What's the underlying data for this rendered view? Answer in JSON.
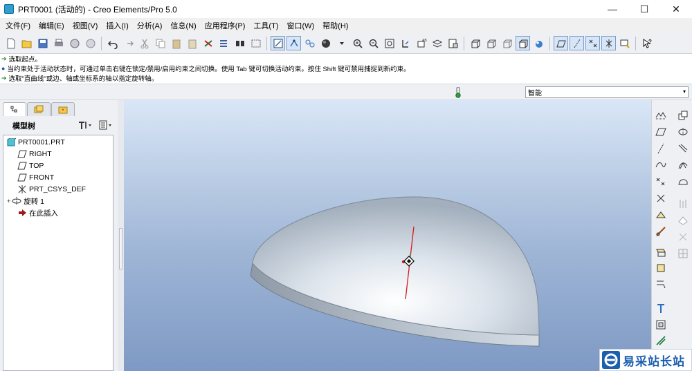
{
  "window": {
    "title": "PRT0001 (活动的) - Creo Elements/Pro 5.0",
    "controls": {
      "minimize": "—",
      "maximize": "☐",
      "close": "✕"
    }
  },
  "menu": [
    "文件(F)",
    "编辑(E)",
    "视图(V)",
    "插入(I)",
    "分析(A)",
    "信息(N)",
    "应用程序(P)",
    "工具(T)",
    "窗口(W)",
    "帮助(H)"
  ],
  "messages": [
    {
      "kind": "prompt",
      "text": "选取起点。"
    },
    {
      "kind": "info",
      "text": "当约束处于活动状态时，可通过单击右键在锁定/禁用/启用约束之间切换。使用 Tab 键可切换活动约束。按住 Shift 键可禁用捕捉到新约束。"
    },
    {
      "kind": "prompt",
      "text": "选取\"直曲线\"或边、轴或坐标系的轴以指定旋转轴。"
    }
  ],
  "filter": {
    "value": "智能",
    "caret": "▾"
  },
  "model_tree": {
    "title": "模型树",
    "items": [
      {
        "label": "PRT0001.PRT",
        "icon": "part-icon"
      },
      {
        "label": "RIGHT",
        "icon": "datum-plane-icon"
      },
      {
        "label": "TOP",
        "icon": "datum-plane-icon"
      },
      {
        "label": "FRONT",
        "icon": "datum-plane-icon"
      },
      {
        "label": "PRT_CSYS_DEF",
        "icon": "csys-icon"
      },
      {
        "label": "旋转 1",
        "icon": "revolve-icon",
        "expander": "+"
      },
      {
        "label": "在此插入",
        "icon": "insert-here-arrow-icon"
      }
    ]
  },
  "watermark": {
    "text": "易采站长站"
  },
  "colors": {
    "accent": "#2e9fd0",
    "insert_arrow": "#a01818",
    "axis_red": "#d21c1c",
    "axis_green": "#2ea043",
    "watermark_blue": "#1c5fae"
  }
}
